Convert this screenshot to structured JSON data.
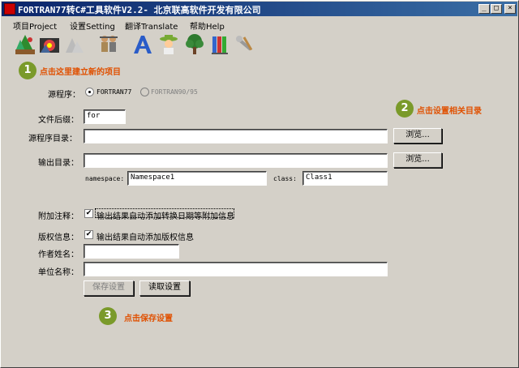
{
  "window": {
    "title": "FORTRAN77转C#工具软件V2.2- 北京联高软件开发有限公司",
    "min_glyph": "_",
    "max_glyph": "□",
    "close_glyph": "×"
  },
  "menu": [
    {
      "label": "项目Project"
    },
    {
      "label": "设置Setting"
    },
    {
      "label": "翻译Translate"
    },
    {
      "label": "帮助Help"
    }
  ],
  "toolbar_icons": [
    "new-project-icon",
    "open-project-icon",
    "disabled-tool-icon",
    "workers-icon",
    "font-icon",
    "person-hat-icon",
    "tree-icon",
    "library-icon",
    "tools-icon"
  ],
  "form": {
    "source_program_label": "源程序：",
    "option_f77": "FORTRAN77",
    "option_f90": "FORTRAN90/95",
    "file_suffix_label": "文件后缀：",
    "file_suffix_value": "for",
    "source_dir_label": "源程序目录：",
    "source_dir_value": "",
    "browse_label": "浏览...",
    "output_dir_label": "输出目录：",
    "output_dir_value": "",
    "namespace_label": "namespace:",
    "namespace_value": "Namespace1",
    "class_label": "class:",
    "class_value": "Class1",
    "annotation_label": "附加注释：",
    "annotation_check": "输出结果自动添加转换日期等附加信息",
    "copyright_label": "版权信息：",
    "copyright_check": "输出结果自动添加版权信息",
    "author_label": "作者姓名：",
    "author_value": "",
    "unit_label": "单位名称：",
    "unit_value": "",
    "save_label": "保存设置",
    "read_label": "读取设置"
  },
  "tips": [
    {
      "num": "1",
      "text": "点击这里建立新的项目"
    },
    {
      "num": "2",
      "text": "点击设置相关目录"
    },
    {
      "num": "3",
      "text": "点击保存设置"
    }
  ],
  "colors": {
    "tip_text": "#e05000",
    "tip_bubble": "#7a9a2a",
    "title_bar": "#0a246a"
  }
}
